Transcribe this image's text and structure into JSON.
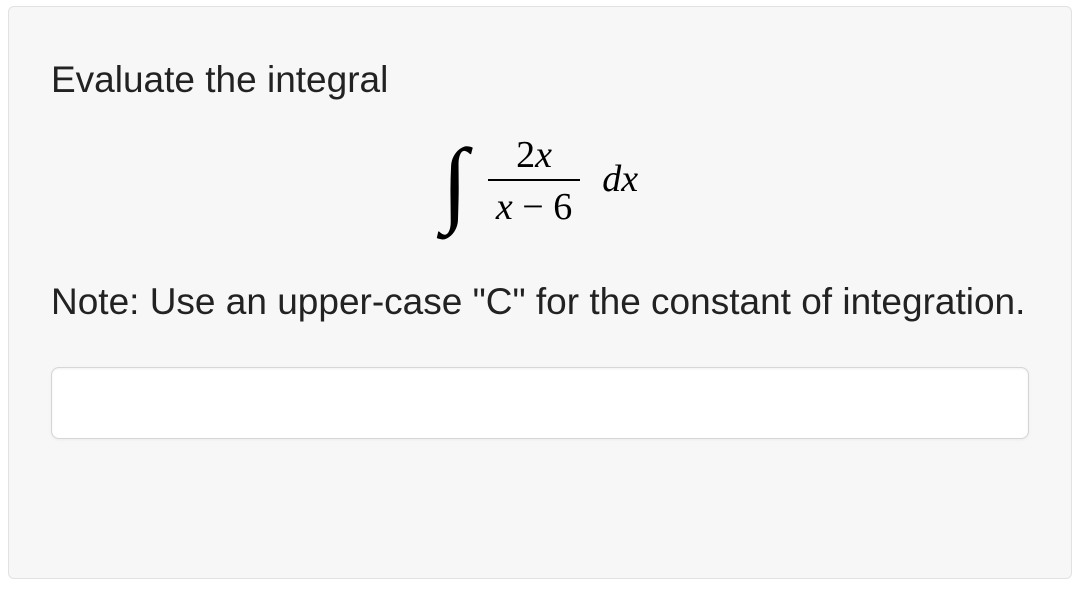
{
  "question": {
    "prompt": "Evaluate the integral",
    "note": "Note: Use an upper-case \"C\" for the constant of integration.",
    "math": {
      "integral_sign": "∫",
      "numerator": "2x",
      "denom_var": "x",
      "denom_minus": " − ",
      "denom_const": "6",
      "dx": "dx"
    },
    "answer_value": ""
  }
}
